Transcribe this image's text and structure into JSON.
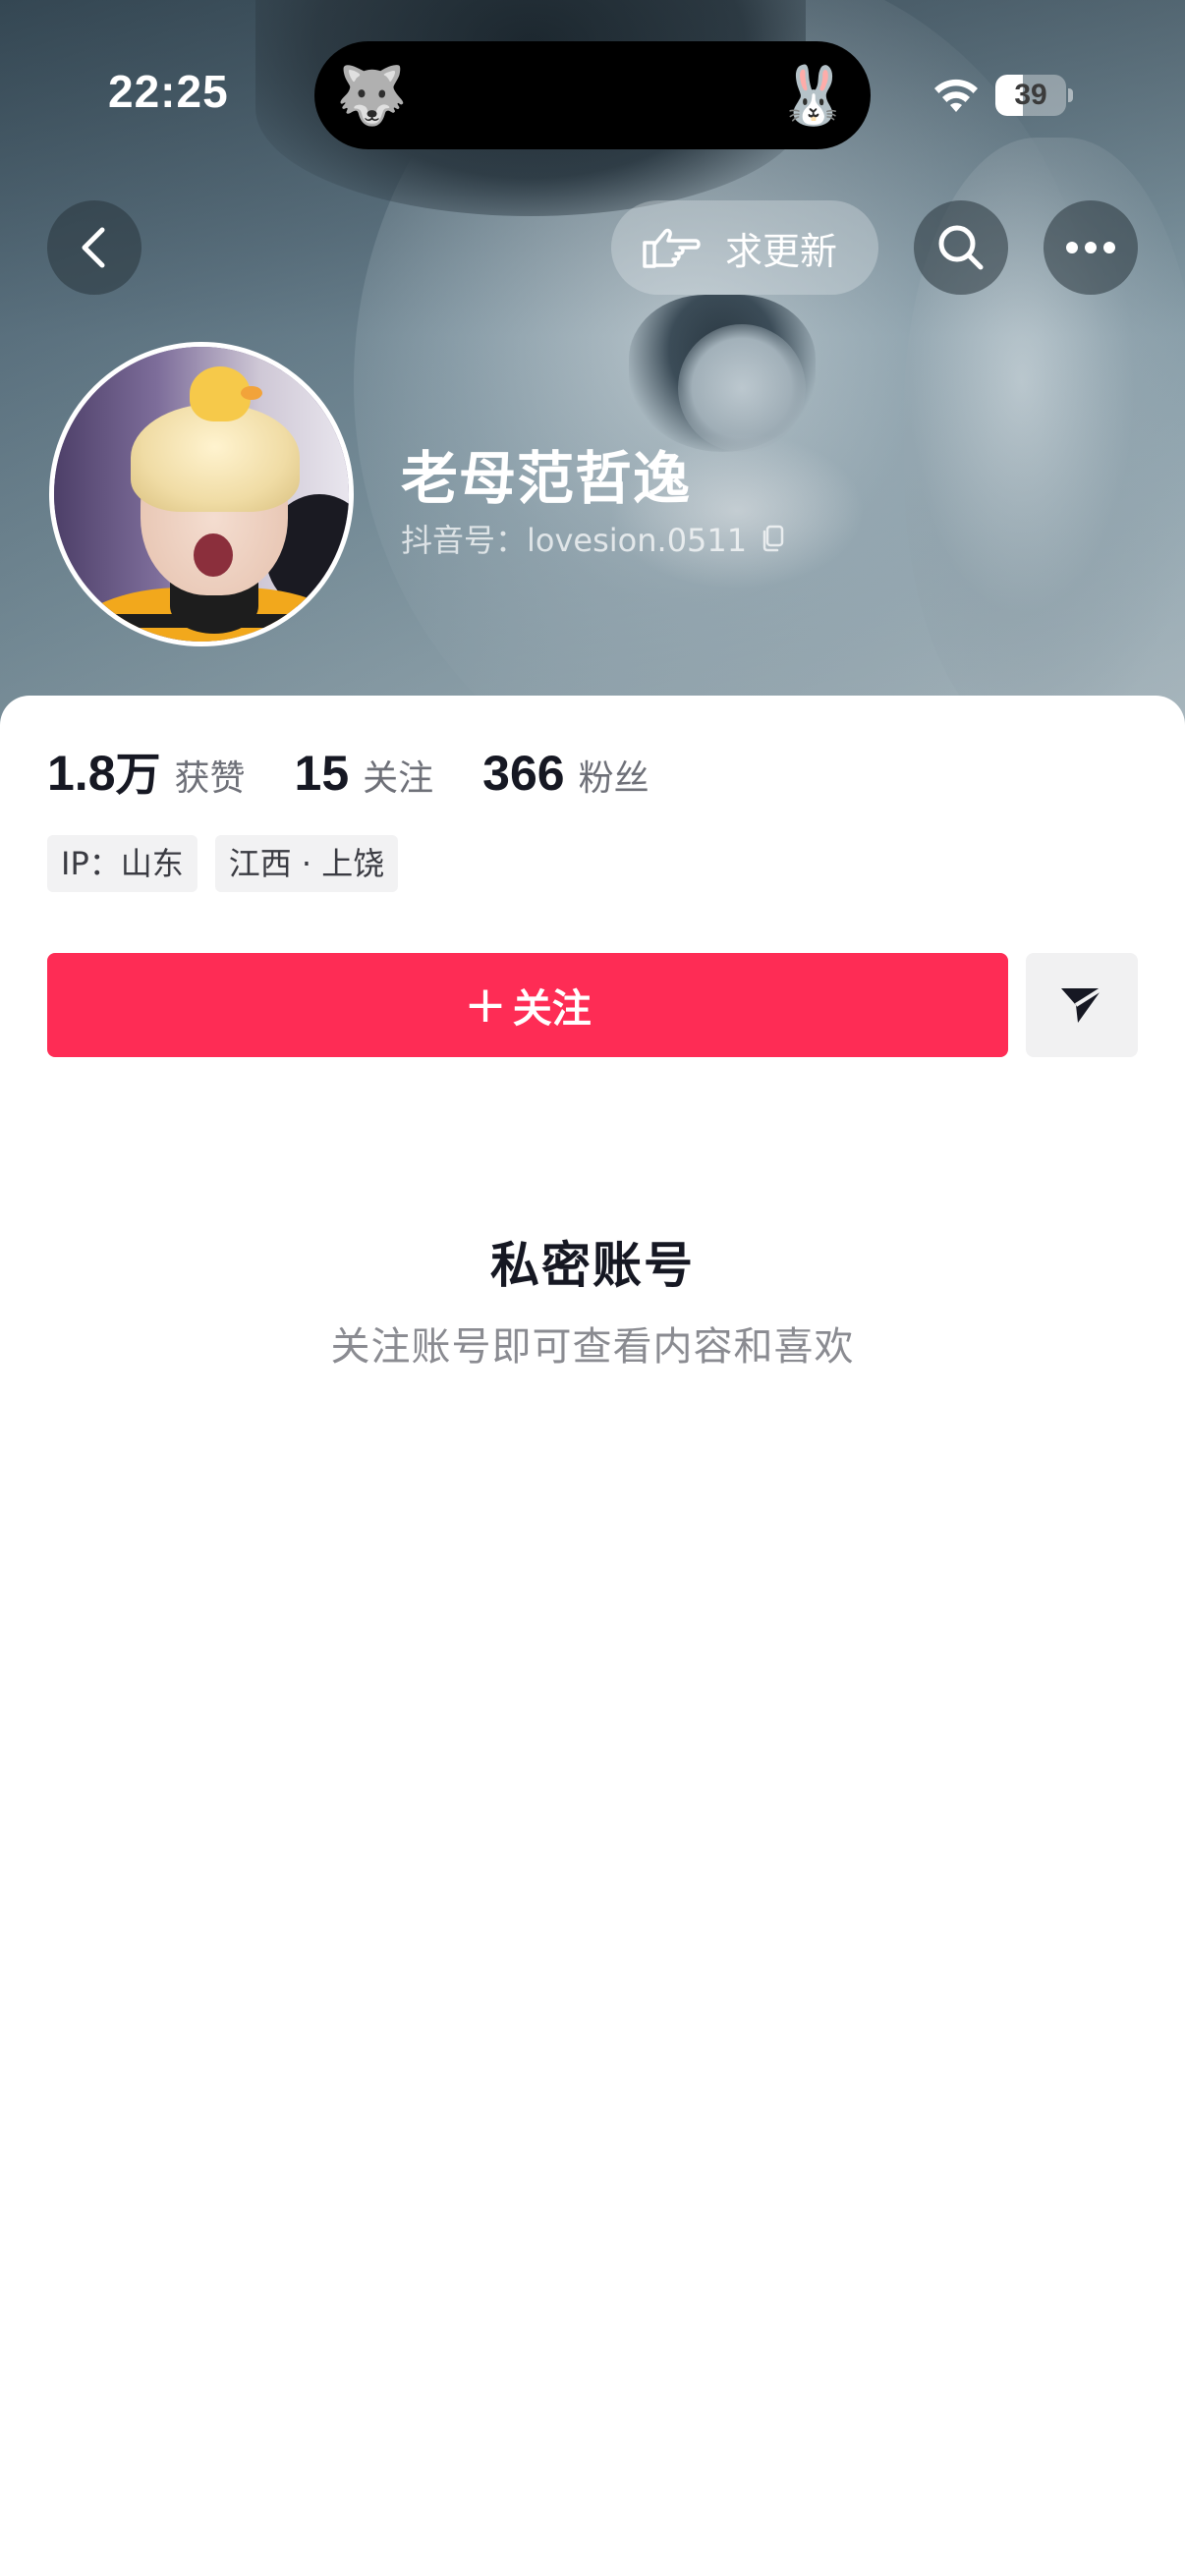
{
  "status_bar": {
    "time": "22:25",
    "island_left_emoji": "🐺",
    "island_right_emoji": "🐰",
    "wifi_icon": "wifi-icon",
    "battery_level": "39",
    "battery_fraction": 0.39
  },
  "top_nav": {
    "back_icon": "chevron-left-icon",
    "request_update_label": "求更新",
    "request_update_icon": "pointing-hand-icon",
    "search_icon": "search-icon",
    "more_icon": "more-dots-icon"
  },
  "profile": {
    "name": "老母范哲逸",
    "douyin_id": "抖音号：lovesion.0511",
    "copy_icon": "copy-icon"
  },
  "stats": [
    {
      "value": "1.8",
      "unit": "万",
      "label": "获赞"
    },
    {
      "value": "15",
      "unit": "",
      "label": "关注"
    },
    {
      "value": "366",
      "unit": "",
      "label": "粉丝"
    }
  ],
  "tags": [
    "IP：山东",
    "江西 · 上饶"
  ],
  "actions": {
    "follow_plus": "+",
    "follow_label": "关注",
    "send_icon": "send-message-icon"
  },
  "private_notice": {
    "title": "私密账号",
    "description": "关注账号即可查看内容和喜欢"
  },
  "colors": {
    "follow_button": "#fe2c55",
    "primary_text": "#161823",
    "secondary_text": "#8a8b91"
  }
}
